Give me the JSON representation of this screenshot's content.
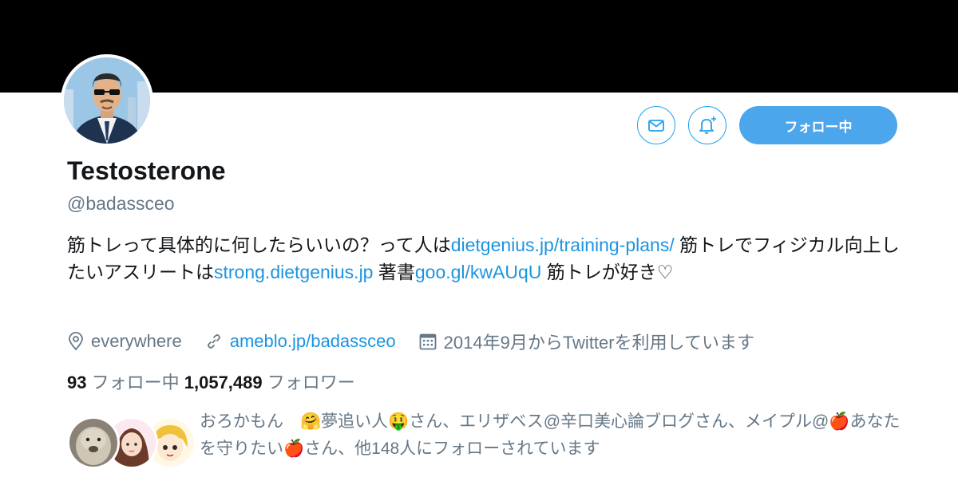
{
  "profile": {
    "name": "Testosterone",
    "handle": "@badassceo",
    "follow_button": "フォロー中"
  },
  "bio": {
    "part1": "筋トレって具体的に何したらいいの？って人は",
    "link1": "dietgenius.jp/training-plans/",
    "part2": " 筋トレでフィジカル向上したいアスリートは",
    "link2": "strong.dietgenius.jp",
    "part3": " 著書",
    "link3": "goo.gl/kwAUqU",
    "part4": " 筋トレが好き♡"
  },
  "meta": {
    "location": "everywhere",
    "website": "ameblo.jp/badassceo",
    "joined": "2014年9月からTwitterを利用しています"
  },
  "stats": {
    "following_count": "93",
    "following_label": "フォロー中",
    "followers_count": "1,057,489",
    "followers_label": "フォロワー"
  },
  "followed_by": {
    "text": "おろかもん　🤗夢追い人🤑さん、エリザベス@辛口美心論ブログさん、メイプル@🍎あなたを守りたい🍎さん、他148人にフォローされています"
  },
  "icons": {
    "message": "envelope-icon",
    "notify": "bell-plus-icon",
    "location": "location-pin-icon",
    "link": "link-icon",
    "calendar": "calendar-icon"
  },
  "colors": {
    "accent": "#1da1f2",
    "link": "#1b95e0",
    "secondary_text": "#657786",
    "follow_button_bg": "#4ca6ec"
  }
}
